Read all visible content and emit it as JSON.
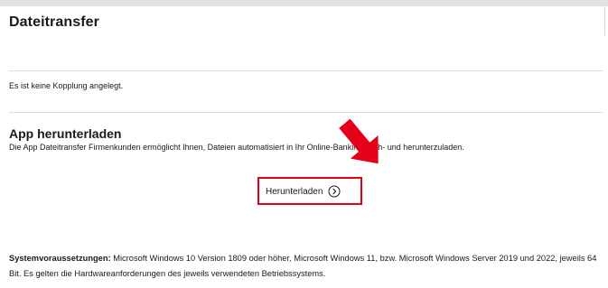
{
  "page": {
    "title": "Dateitransfer"
  },
  "pairing": {
    "status_text": "Es ist keine Kopplung angelegt."
  },
  "download_section": {
    "title": "App herunterladen",
    "description": "Die App Dateitransfer Firmenkunden ermöglicht Ihnen, Dateien automatisiert in Ihr Online-Banking hoch- und herunterzuladen.",
    "button_label": "Herunterladen",
    "button_icon": "chevron-right-circle-icon"
  },
  "system_requirements": {
    "label": "Systemvoraussetzungen:",
    "text": " Microsoft Windows 10 Version 1809 oder höher, Microsoft Windows 11, bzw. Microsoft Windows Server 2019 und 2022, jeweils 64 Bit. Es gelten die Hardwareanforderungen des jeweils verwendeten Betriebssystems."
  },
  "colors": {
    "highlight": "#e5001a",
    "text": "#1a1a1a",
    "divider": "#dcdcdc"
  }
}
